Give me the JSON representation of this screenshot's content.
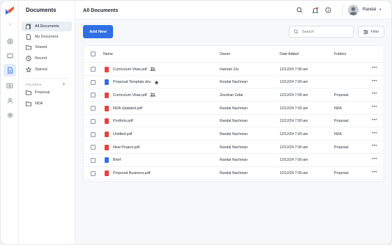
{
  "sidebar": {
    "title": "Documents",
    "items": [
      {
        "label": "All Documents",
        "icon": "documents-icon"
      },
      {
        "label": "My Document",
        "icon": "document-icon"
      },
      {
        "label": "Shared",
        "icon": "folder-icon"
      },
      {
        "label": "Recent",
        "icon": "clock-icon"
      },
      {
        "label": "Starred",
        "icon": "star-icon"
      }
    ],
    "folders_heading": "FOLDERS",
    "folders": [
      {
        "label": "Proposal",
        "icon": "folder-icon"
      },
      {
        "label": "NDA",
        "icon": "folder-icon"
      }
    ]
  },
  "topbar": {
    "title": "All Documents",
    "user_name": "Randal"
  },
  "toolbar": {
    "add_label": "Add New",
    "search_placeholder": "Search",
    "filter_label": "Filter"
  },
  "table": {
    "headers": {
      "name": "Name",
      "owner": "Owner",
      "date": "Date Added",
      "folders": "Folders"
    },
    "rows": [
      {
        "name": "Curriculum Vitae.pdf",
        "type": "pdf",
        "badge": "shared",
        "owner": "Hamam Zai",
        "date": "12/12/24 7:00 am",
        "folder": ""
      },
      {
        "name": "Proposal Template.doc",
        "type": "doc",
        "badge": "starred",
        "owner": "Randal Nachman",
        "date": "12/12/24 7:00 am",
        "folder": ""
      },
      {
        "name": "Curriculum Vitae.pdf",
        "type": "pdf",
        "badge": "shared",
        "owner": "Zeeshan Zafar",
        "date": "12/12/24 7:00 am",
        "folder": "Proposal"
      },
      {
        "name": "NDA Updated.pdf",
        "type": "pdf",
        "badge": "",
        "owner": "Randal Nachman",
        "date": "12/12/24 7:00 am",
        "folder": "NDA"
      },
      {
        "name": "Portfolio.pdf",
        "type": "pdf",
        "badge": "",
        "owner": "Randal Nachman",
        "date": "12/12/24 7:00 am",
        "folder": "Proposal"
      },
      {
        "name": "Untitled.pdf",
        "type": "pdf",
        "badge": "",
        "owner": "Randal Nachman",
        "date": "12/12/24 7:00 am",
        "folder": "NDA"
      },
      {
        "name": "New Project.pdf",
        "type": "pdf",
        "badge": "",
        "owner": "Randal Nachman",
        "date": "12/12/24 7:00 am",
        "folder": "Proposal"
      },
      {
        "name": "Brief",
        "type": "doc",
        "badge": "",
        "owner": "Randal Nachman",
        "date": "12/12/24 7:00 am",
        "folder": ""
      },
      {
        "name": "Proposal Business.pdf",
        "type": "pdf",
        "badge": "",
        "owner": "Randal Nachman",
        "date": "12/12/24 7:00 am",
        "folder": "Proposal"
      }
    ]
  },
  "colors": {
    "accent": "#2f6fe4",
    "pdf": "#e8413b",
    "doc": "#2f6fe4"
  }
}
